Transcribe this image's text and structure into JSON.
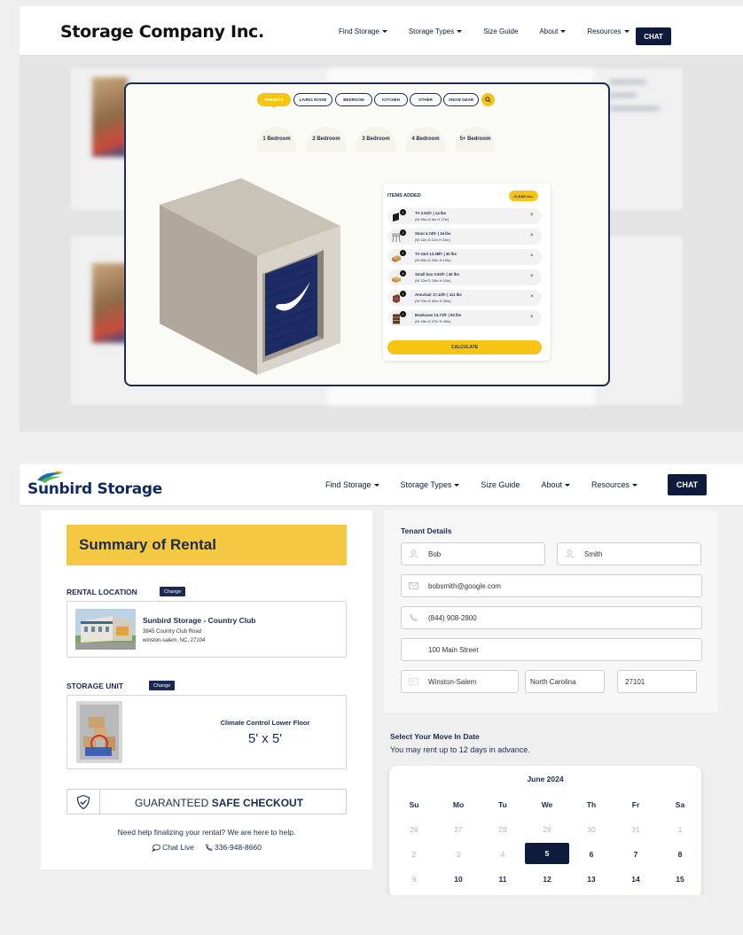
{
  "top": {
    "brand": "Storage Company Inc.",
    "nav": [
      "Find Storage",
      "Storage Types",
      "Size Guide",
      "About",
      "Resources"
    ],
    "nav_has_caret": [
      true,
      true,
      false,
      true,
      true
    ],
    "chat": "CHAT",
    "tabs": [
      "PRESETS",
      "LIVING ROOM",
      "BEDROOM",
      "KITCHEN",
      "OTHER",
      "SNOW GEAR"
    ],
    "presets": [
      "1 Bedroom",
      "2 Bedroom",
      "3 Bedroom",
      "4 Bedroom",
      "5+ Bedroom"
    ],
    "items_title": "ITEMS ADDED",
    "clear_all": "CLEAR ALL",
    "items": [
      {
        "num": "1",
        "line1": "TV 2.51ft³ | 14 lbs",
        "line2": "(W 35in D 5in H 27in)",
        "icon": "tv-icon"
      },
      {
        "num": "2",
        "line1": "Stool 4.74ft³ | 16 lbs",
        "line2": "(W 11in D 11in H 31in)",
        "icon": "stool-icon"
      },
      {
        "num": "1",
        "line1": "TV Unit 13.38ft³ | 40 lbs",
        "line2": "(W 55in D 20in H 19in)",
        "icon": "tv-unit-icon"
      },
      {
        "num": "4",
        "line1": "Small box 0.61ft³ | 40 lbs",
        "line2": "(W 12in D 15in H 10in)",
        "icon": "small-box-icon"
      },
      {
        "num": "1",
        "line1": "Armchair 17.12ft³ | 111 lbs",
        "line2": "(W 29in D 32in H 32in)",
        "icon": "armchair-icon"
      },
      {
        "num": "1",
        "line1": "Bookcase 13.71ft³ | 83 lbs",
        "line2": "(W 18in D 27in H 49in)",
        "icon": "bookcase-icon"
      }
    ],
    "calculate": "CALCULATE"
  },
  "bottom": {
    "brand": "Sunbird Storage",
    "nav": [
      "Find Storage",
      "Storage Types",
      "Size Guide",
      "About",
      "Resources"
    ],
    "nav_has_caret": [
      true,
      true,
      false,
      true,
      true
    ],
    "chat": "CHAT",
    "summary_title": "Summary of Rental",
    "rental_location_label": "RENTAL LOCATION",
    "change": "Change",
    "location_name": "Sunbird Storage - Country Club",
    "location_addr1": "3845 Country Club Road",
    "location_addr2": "winston-salem, NC, 27104",
    "storage_unit_label": "STORAGE UNIT",
    "unit_name": "Climate Control Lower Floor",
    "unit_size": "5' x 5'",
    "guarantee_prefix": "GUARANTEED ",
    "guarantee_bold": "SAFE CHECKOUT",
    "help_text": "Need help finalizing your rental? We are here to help.",
    "chat_live": "Chat Live",
    "phone": "336-948-8660",
    "tenant_title": "Tenant Details",
    "first_name": "Bob",
    "last_name": "Smith",
    "email": "bobsmith@google.com",
    "tel": "(844) 908-2800",
    "street": "100 Main Street",
    "city": "Winston-Salem",
    "state": "North Carolina",
    "zip": "27101",
    "movein_title": "Select Your Move In Date",
    "movein_sub": "You may rent up to 12 days in advance.",
    "calendar": {
      "month": "June 2024",
      "weekdays": [
        "Su",
        "Mo",
        "Tu",
        "We",
        "Th",
        "Fr",
        "Sa"
      ],
      "rows": [
        [
          "26",
          "27",
          "28",
          "29",
          "30",
          "31",
          "1"
        ],
        [
          "2",
          "3",
          "4",
          "5",
          "6",
          "7",
          "8"
        ],
        [
          "9",
          "10",
          "11",
          "12",
          "13",
          "14",
          "15"
        ]
      ],
      "selected": "5"
    }
  },
  "colors": {
    "navy": "#0f1b3d",
    "yellow": "#f6c514",
    "summary_yellow": "#f5c842"
  }
}
